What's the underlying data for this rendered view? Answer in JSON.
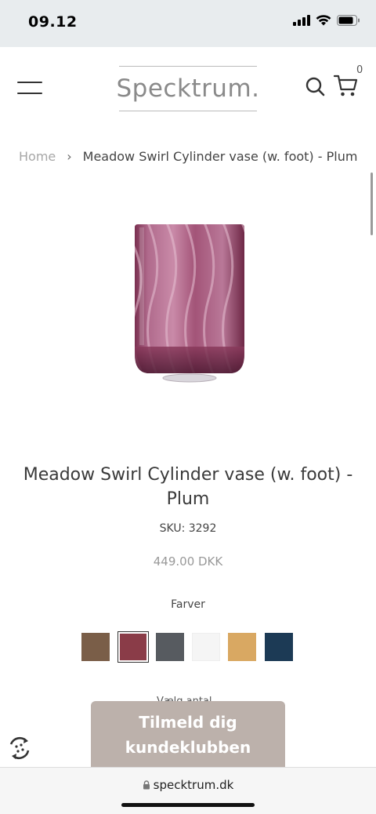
{
  "status_bar": {
    "time": "09.12"
  },
  "header": {
    "logo": "Specktrum.",
    "cart_count": "0"
  },
  "breadcrumb": {
    "home": "Home",
    "separator": "›",
    "current": "Meadow Swirl Cylinder vase (w. foot) - Plum"
  },
  "product": {
    "title": "Meadow Swirl Cylinder vase (w. foot) - Plum",
    "sku": "SKU: 3292",
    "price": "449.00 DKK",
    "color_label": "Farver",
    "swatches": [
      {
        "color": "#7a5e48"
      },
      {
        "color": "#8a3c48",
        "selected": true
      },
      {
        "color": "#575b60"
      },
      {
        "color": "#f5f5f5"
      },
      {
        "color": "#d9a862"
      },
      {
        "color": "#1c3a55"
      }
    ]
  },
  "partial_text": "Vælg antal",
  "newsletter": {
    "line1": "Tilmeld dig",
    "line2": "kundeklubben"
  },
  "browser": {
    "url": "specktrum.dk"
  }
}
